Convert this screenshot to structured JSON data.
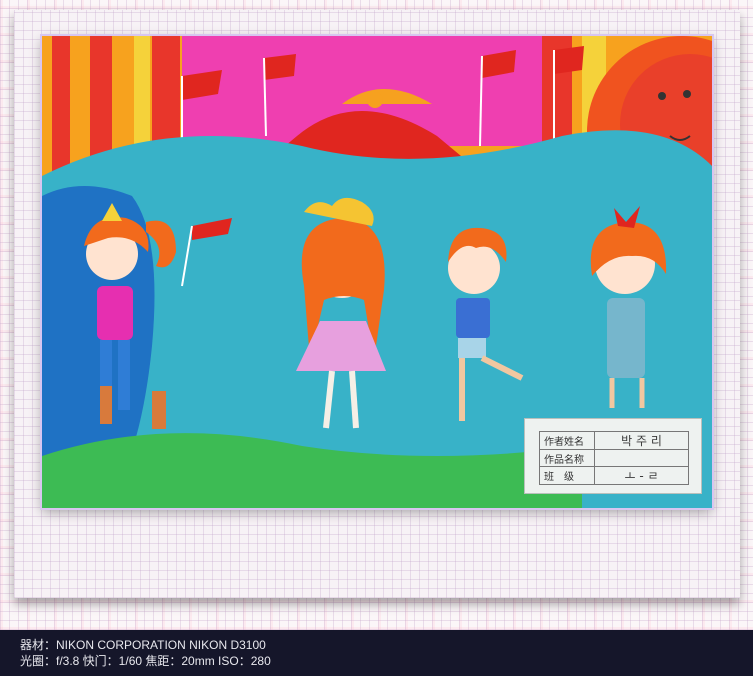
{
  "viewer": {
    "background": "#fbf6f8"
  },
  "artwork": {
    "label_card": {
      "rows": [
        {
          "key": "作者姓名",
          "value": "박 주 리"
        },
        {
          "key": "作品名称",
          "value": ""
        },
        {
          "key": "班　级",
          "value": "ㅗ - ㄹ"
        }
      ]
    }
  },
  "exif": {
    "line1": "器材：NIKON CORPORATION   NIKON D3100",
    "line2": "光圈：f/3.8  快门：1/60  焦距：20mm  ISO：280"
  },
  "colors": {
    "footer_bg": "#15162a",
    "footer_text": "#e8e8ee",
    "frame_glow": "#d8c6f0"
  }
}
